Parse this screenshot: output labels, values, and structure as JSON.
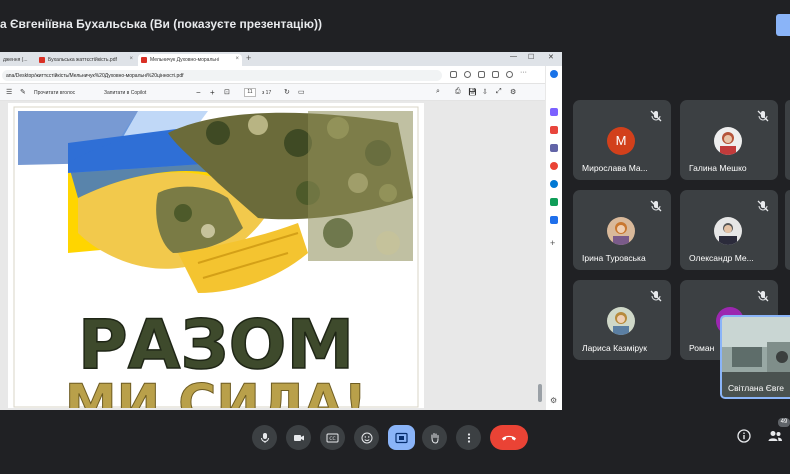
{
  "meeting": {
    "title": "а Євгеніївна Бухальська (Ви (показуєте презентацію))"
  },
  "browser": {
    "tabs": [
      {
        "label": "Бухальська жаттєстійкість.pdf"
      },
      {
        "label": "Мельничук Духовно-моральні"
      },
      {
        "label": "дження (..."
      }
    ],
    "url": "ana/Desktop/життєстійкість/Мельничук%20Духовно-моральні%20цінності.pdf",
    "pdf_toolbar": {
      "read_aloud": "Прочитати вголос",
      "ask_copilot": "Запитати в Copilot",
      "zoom_minus": "−",
      "zoom_plus": "+",
      "page_current": "11",
      "page_total": "з 17"
    },
    "poster": {
      "line1": "РАЗОМ",
      "line2": "МИ СИЛА!"
    }
  },
  "participants": [
    {
      "name": "Мирослава Ма...",
      "avatar": "letter",
      "letter": "М"
    },
    {
      "name": "Галина Мешко",
      "avatar": "photo"
    },
    {
      "name": "Ірина Туровська",
      "avatar": "photo"
    },
    {
      "name": "Олександр Ме...",
      "avatar": "photo"
    },
    {
      "name": "Лариса Казмірук",
      "avatar": "photo"
    },
    {
      "name": "Роман",
      "avatar": "photo"
    }
  ],
  "self_view": {
    "name": "Світлана Євге"
  },
  "controls": {
    "people_count": "49"
  },
  "colors": {
    "background": "#202124",
    "tile": "#3c4043",
    "accent": "#8ab4f8",
    "end_call": "#ea4335"
  }
}
